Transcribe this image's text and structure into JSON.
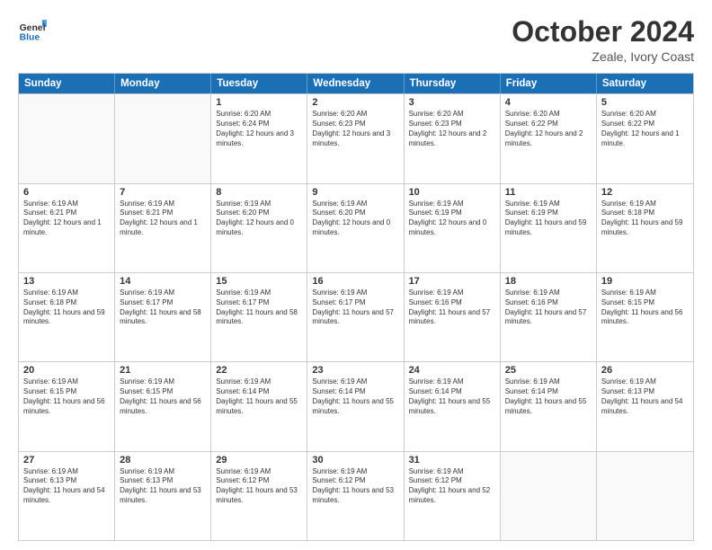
{
  "header": {
    "logo_general": "General",
    "logo_blue": "Blue",
    "month": "October 2024",
    "location": "Zeale, Ivory Coast"
  },
  "days_of_week": [
    "Sunday",
    "Monday",
    "Tuesday",
    "Wednesday",
    "Thursday",
    "Friday",
    "Saturday"
  ],
  "weeks": [
    [
      {
        "day": "",
        "empty": true
      },
      {
        "day": "",
        "empty": true
      },
      {
        "day": "1",
        "sunrise": "6:20 AM",
        "sunset": "6:24 PM",
        "daylight": "12 hours and 3 minutes."
      },
      {
        "day": "2",
        "sunrise": "6:20 AM",
        "sunset": "6:23 PM",
        "daylight": "12 hours and 3 minutes."
      },
      {
        "day": "3",
        "sunrise": "6:20 AM",
        "sunset": "6:23 PM",
        "daylight": "12 hours and 2 minutes."
      },
      {
        "day": "4",
        "sunrise": "6:20 AM",
        "sunset": "6:22 PM",
        "daylight": "12 hours and 2 minutes."
      },
      {
        "day": "5",
        "sunrise": "6:20 AM",
        "sunset": "6:22 PM",
        "daylight": "12 hours and 1 minute."
      }
    ],
    [
      {
        "day": "6",
        "sunrise": "6:19 AM",
        "sunset": "6:21 PM",
        "daylight": "12 hours and 1 minute."
      },
      {
        "day": "7",
        "sunrise": "6:19 AM",
        "sunset": "6:21 PM",
        "daylight": "12 hours and 1 minute."
      },
      {
        "day": "8",
        "sunrise": "6:19 AM",
        "sunset": "6:20 PM",
        "daylight": "12 hours and 0 minutes."
      },
      {
        "day": "9",
        "sunrise": "6:19 AM",
        "sunset": "6:20 PM",
        "daylight": "12 hours and 0 minutes."
      },
      {
        "day": "10",
        "sunrise": "6:19 AM",
        "sunset": "6:19 PM",
        "daylight": "12 hours and 0 minutes."
      },
      {
        "day": "11",
        "sunrise": "6:19 AM",
        "sunset": "6:19 PM",
        "daylight": "11 hours and 59 minutes."
      },
      {
        "day": "12",
        "sunrise": "6:19 AM",
        "sunset": "6:18 PM",
        "daylight": "11 hours and 59 minutes."
      }
    ],
    [
      {
        "day": "13",
        "sunrise": "6:19 AM",
        "sunset": "6:18 PM",
        "daylight": "11 hours and 59 minutes."
      },
      {
        "day": "14",
        "sunrise": "6:19 AM",
        "sunset": "6:17 PM",
        "daylight": "11 hours and 58 minutes."
      },
      {
        "day": "15",
        "sunrise": "6:19 AM",
        "sunset": "6:17 PM",
        "daylight": "11 hours and 58 minutes."
      },
      {
        "day": "16",
        "sunrise": "6:19 AM",
        "sunset": "6:17 PM",
        "daylight": "11 hours and 57 minutes."
      },
      {
        "day": "17",
        "sunrise": "6:19 AM",
        "sunset": "6:16 PM",
        "daylight": "11 hours and 57 minutes."
      },
      {
        "day": "18",
        "sunrise": "6:19 AM",
        "sunset": "6:16 PM",
        "daylight": "11 hours and 57 minutes."
      },
      {
        "day": "19",
        "sunrise": "6:19 AM",
        "sunset": "6:15 PM",
        "daylight": "11 hours and 56 minutes."
      }
    ],
    [
      {
        "day": "20",
        "sunrise": "6:19 AM",
        "sunset": "6:15 PM",
        "daylight": "11 hours and 56 minutes."
      },
      {
        "day": "21",
        "sunrise": "6:19 AM",
        "sunset": "6:15 PM",
        "daylight": "11 hours and 56 minutes."
      },
      {
        "day": "22",
        "sunrise": "6:19 AM",
        "sunset": "6:14 PM",
        "daylight": "11 hours and 55 minutes."
      },
      {
        "day": "23",
        "sunrise": "6:19 AM",
        "sunset": "6:14 PM",
        "daylight": "11 hours and 55 minutes."
      },
      {
        "day": "24",
        "sunrise": "6:19 AM",
        "sunset": "6:14 PM",
        "daylight": "11 hours and 55 minutes."
      },
      {
        "day": "25",
        "sunrise": "6:19 AM",
        "sunset": "6:14 PM",
        "daylight": "11 hours and 55 minutes."
      },
      {
        "day": "26",
        "sunrise": "6:19 AM",
        "sunset": "6:13 PM",
        "daylight": "11 hours and 54 minutes."
      }
    ],
    [
      {
        "day": "27",
        "sunrise": "6:19 AM",
        "sunset": "6:13 PM",
        "daylight": "11 hours and 54 minutes."
      },
      {
        "day": "28",
        "sunrise": "6:19 AM",
        "sunset": "6:13 PM",
        "daylight": "11 hours and 53 minutes."
      },
      {
        "day": "29",
        "sunrise": "6:19 AM",
        "sunset": "6:12 PM",
        "daylight": "11 hours and 53 minutes."
      },
      {
        "day": "30",
        "sunrise": "6:19 AM",
        "sunset": "6:12 PM",
        "daylight": "11 hours and 53 minutes."
      },
      {
        "day": "31",
        "sunrise": "6:19 AM",
        "sunset": "6:12 PM",
        "daylight": "11 hours and 52 minutes."
      },
      {
        "day": "",
        "empty": true
      },
      {
        "day": "",
        "empty": true
      }
    ]
  ]
}
